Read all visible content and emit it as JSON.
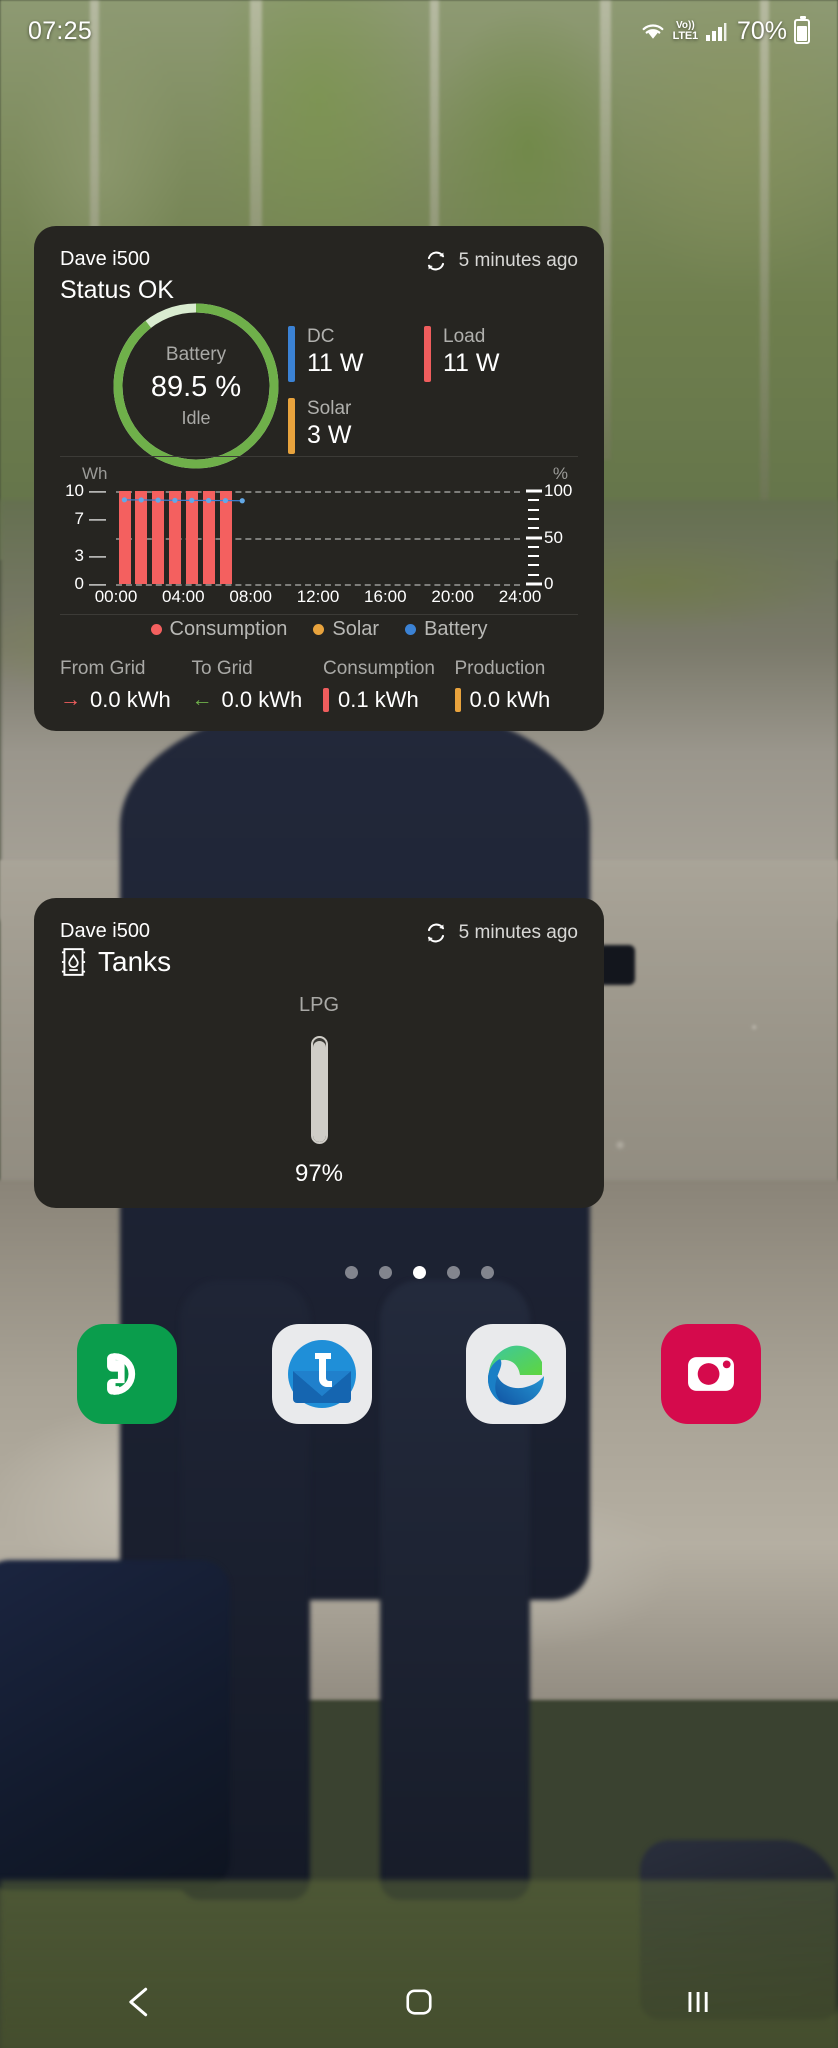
{
  "statusbar": {
    "clock": "07:25",
    "wifi_icon": "wifi-icon",
    "volte_top": "Vo))",
    "volte_bottom": "LTE1",
    "signal_icon": "cellular-signal-icon",
    "battery_percent": "70%",
    "battery_icon": "battery-icon"
  },
  "energy_card": {
    "device_name": "Dave i500",
    "status": "Status OK",
    "sync_icon": "refresh-icon",
    "sync_text": "5 minutes ago",
    "battery_ring": {
      "label": "Battery",
      "value": "89.5 %",
      "state": "Idle",
      "percent": 89.5,
      "color": "#6fb04a",
      "track_color": "#d9ecd0"
    },
    "metrics": [
      {
        "label": "DC",
        "value": "11 W",
        "color": "#3b82d4"
      },
      {
        "label": "Load",
        "value": "11 W",
        "color": "#ef5d5d"
      },
      {
        "label": "Solar",
        "value": "3 W",
        "color": "#e8a33d"
      }
    ],
    "legend": [
      {
        "label": "Consumption",
        "color": "#f4605f"
      },
      {
        "label": "Solar",
        "color": "#e8a33d"
      },
      {
        "label": "Battery",
        "color": "#3b82d4"
      }
    ],
    "footer_stats": [
      {
        "label": "From Grid",
        "value": "0.0 kWh",
        "marker": "arrow-right",
        "color": "#ef5d5d"
      },
      {
        "label": "To Grid",
        "value": "0.0 kWh",
        "marker": "arrow-left",
        "color": "#6fb04a"
      },
      {
        "label": "Consumption",
        "value": "0.1 kWh",
        "marker": "bar",
        "color": "#ef5d5d"
      },
      {
        "label": "Production",
        "value": "0.0 kWh",
        "marker": "bar",
        "color": "#e8a33d"
      }
    ]
  },
  "chart_data": {
    "type": "bar",
    "title": "",
    "ylabel": "Wh",
    "y2label": "%",
    "xlabel": "",
    "ylim": [
      0,
      10
    ],
    "y2lim": [
      0,
      100
    ],
    "yticks": [
      0,
      3,
      7,
      10
    ],
    "y2ticks": [
      0,
      50,
      100
    ],
    "grid": true,
    "gridlines": [
      0,
      5,
      10
    ],
    "legend_position": "bottom",
    "xticks": [
      "00:00",
      "04:00",
      "08:00",
      "12:00",
      "16:00",
      "20:00",
      "24:00"
    ],
    "x_hours": [
      0,
      1,
      2,
      3,
      4,
      5,
      6
    ],
    "series": [
      {
        "name": "Consumption",
        "type": "bar",
        "color": "#f4605f",
        "axis": "left",
        "values": [
          10,
          10,
          10,
          10,
          10,
          10,
          10
        ]
      },
      {
        "name": "Solar",
        "type": "bar",
        "color": "#e8a33d",
        "axis": "left",
        "values": [
          0,
          0,
          0,
          0,
          0,
          0,
          0
        ]
      },
      {
        "name": "Battery",
        "type": "line",
        "color": "#3b82d4",
        "axis": "right",
        "x": [
          0,
          1,
          2,
          3,
          4,
          5,
          6,
          7
        ],
        "values": [
          90.5,
          90.4,
          90.2,
          90.0,
          89.9,
          89.8,
          89.7,
          89.5
        ]
      }
    ]
  },
  "tanks_card": {
    "device_name": "Dave i500",
    "title": "Tanks",
    "tank_icon": "tank-icon",
    "sync_icon": "refresh-icon",
    "sync_text": "5 minutes ago",
    "tanks": [
      {
        "label": "LPG",
        "value": "97%",
        "percent": 97,
        "color": "#cfcdc7"
      }
    ]
  },
  "home": {
    "page_dots": {
      "count": 5,
      "active_index": 2
    },
    "dock": [
      {
        "name": "phone-app",
        "label": "Phone",
        "bg": "#0a9d4c",
        "icon": "phone-icon"
      },
      {
        "name": "telenor-app",
        "label": "Telenor",
        "bg": "#e9eaec",
        "icon": "t-envelope-icon"
      },
      {
        "name": "edge-app",
        "label": "Edge",
        "bg": "#e9eaec",
        "icon": "edge-icon"
      },
      {
        "name": "camera-app",
        "label": "Camera",
        "bg": "#d50a4c",
        "icon": "camera-icon"
      }
    ],
    "navbar": [
      {
        "name": "back-button",
        "icon": "chevron-left-icon"
      },
      {
        "name": "home-button",
        "icon": "square-icon"
      },
      {
        "name": "recents-button",
        "icon": "recents-icon"
      }
    ]
  }
}
